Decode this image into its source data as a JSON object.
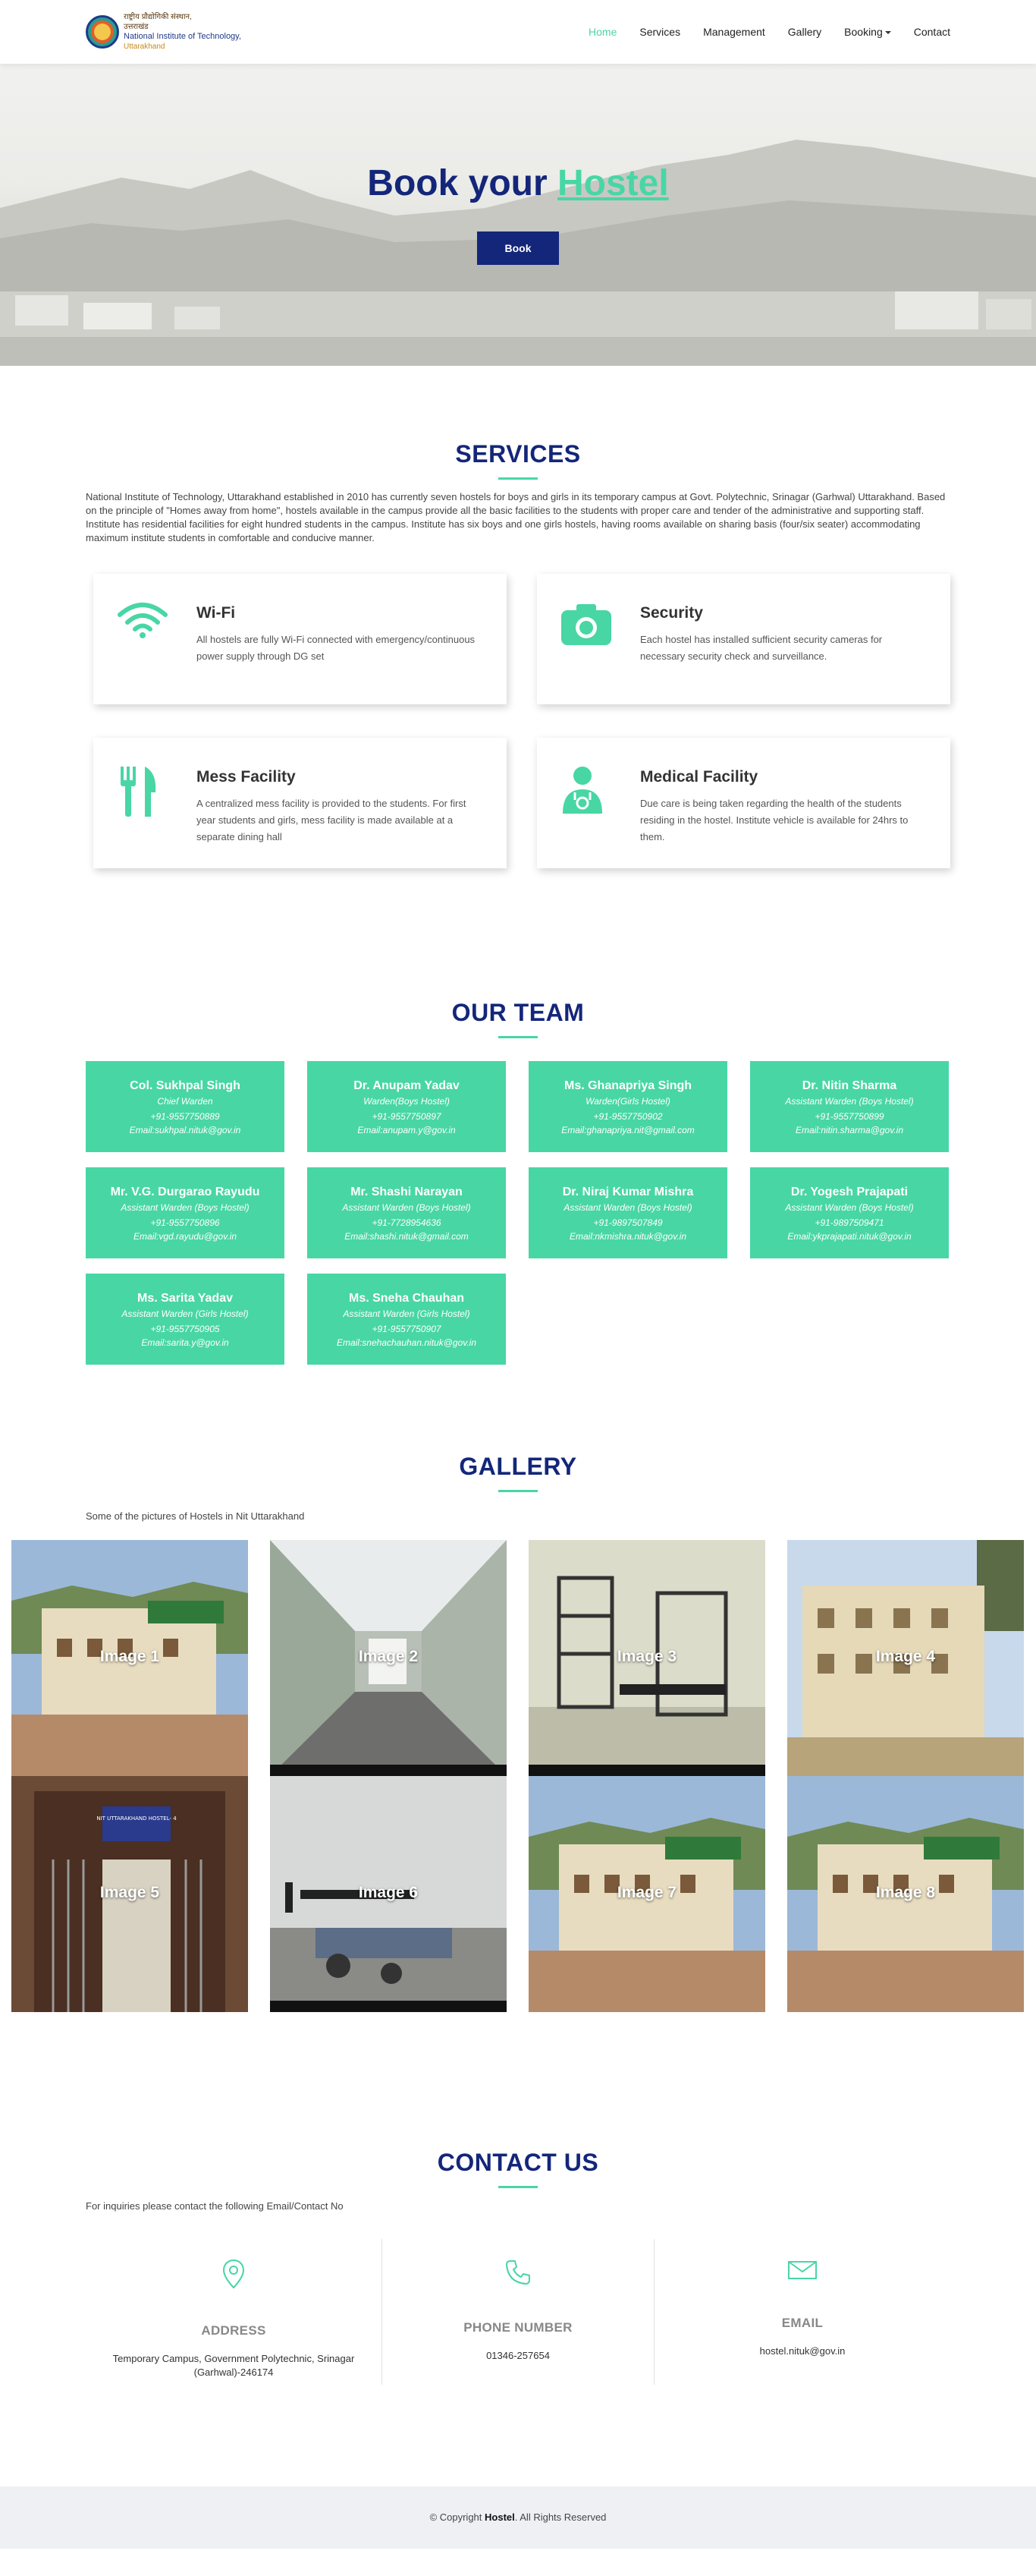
{
  "brand": {
    "line1": "राष्ट्रीय प्रौद्योगिकी संस्थान,",
    "line2": "उत्तराखंड",
    "line3": "National Institute of Technology,",
    "line4": "Uttarakhand"
  },
  "nav": {
    "items": [
      "Home",
      "Services",
      "Management",
      "Gallery",
      "Booking",
      "Contact"
    ]
  },
  "hero": {
    "title_prefix": "Book your ",
    "title_accent": "Hostel",
    "button": "Book"
  },
  "services": {
    "title": "SERVICES",
    "intro": "National Institute of Technology, Uttarakhand established in 2010 has currently seven hostels for boys and girls in its temporary campus at Govt. Polytechnic, Srinagar (Garhwal) Uttarakhand. Based on the principle of \"Homes away from home\", hostels available in the campus provide all the basic facilities to the students with proper care and tender of the administrative and supporting staff. Institute has residential facilities for eight hundred students in the campus. Institute has six boys and one girls hostels, having rooms available on sharing basis (four/six seater) accommodating maximum institute students in comfortable and conducive manner.",
    "cards": [
      {
        "title": "Wi-Fi",
        "text": "All hostels are fully Wi-Fi connected with emergency/continuous power supply through DG set",
        "icon": "wifi-icon"
      },
      {
        "title": "Security",
        "text": "Each hostel has installed sufficient security cameras for necessary security check and surveillance.",
        "icon": "camera-icon"
      },
      {
        "title": "Mess Facility",
        "text": "A centralized mess facility is provided to the students. For first year students and girls, mess facility is made available at a separate dining hall",
        "icon": "utensils-icon"
      },
      {
        "title": "Medical Facility",
        "text": "Due care is being taken regarding the health of the students residing in the hostel. Institute vehicle is available for 24hrs to them.",
        "icon": "doctor-icon"
      }
    ]
  },
  "team": {
    "title": "OUR TEAM",
    "members": [
      {
        "name": "Col. Sukhpal Singh",
        "role": "Chief Warden",
        "phone": "+91-9557750889",
        "email": "Email:sukhpal.nituk@gov.in"
      },
      {
        "name": "Dr. Anupam Yadav",
        "role": "Warden(Boys Hostel)",
        "phone": "+91-9557750897",
        "email": "Email:anupam.y@gov.in"
      },
      {
        "name": "Ms. Ghanapriya Singh",
        "role": "Warden(Girls Hostel)",
        "phone": "+91-9557750902",
        "email": "Email:ghanapriya.nit@gmail.com"
      },
      {
        "name": "Dr. Nitin Sharma",
        "role": "Assistant Warden (Boys Hostel)",
        "phone": "+91-9557750899",
        "email": "Email:nitin.sharma@gov.in"
      },
      {
        "name": "Mr. V.G. Durgarao Rayudu",
        "role": "Assistant Warden (Boys Hostel)",
        "phone": "+91-9557750896",
        "email": "Email:vgd.rayudu@gov.in"
      },
      {
        "name": "Mr. Shashi Narayan",
        "role": "Assistant Warden (Boys Hostel)",
        "phone": "+91-7728954636",
        "email": "Email:shashi.nituk@gmail.com"
      },
      {
        "name": "Dr. Niraj Kumar Mishra",
        "role": "Assistant Warden (Boys Hostel)",
        "phone": "+91-9897507849",
        "email": "Email:nkmishra.nituk@gov.in"
      },
      {
        "name": "Dr. Yogesh Prajapati",
        "role": "Assistant Warden (Boys Hostel)",
        "phone": "+91-9897509471",
        "email": "Email:ykprajapati.nituk@gov.in"
      },
      {
        "name": "Ms. Sarita Yadav",
        "role": "Assistant Warden (Girls Hostel)",
        "phone": "+91-9557750905",
        "email": "Email:sarita.y@gov.in"
      },
      {
        "name": "Ms. Sneha Chauhan",
        "role": "Assistant Warden (Girls Hostel)",
        "phone": "+91-9557750907",
        "email": "Email:snehachauhan.nituk@gov.in"
      }
    ]
  },
  "gallery": {
    "title": "GALLERY",
    "subtitle": "Some of the pictures of Hostels in Nit Uttarakhand",
    "items": [
      "Image 1",
      "Image 2",
      "Image 3",
      "Image 4",
      "Image 5",
      "Image 6",
      "Image 7",
      "Image 8"
    ],
    "sign_text": "NIT UTTARAKHAND HOSTEL- 4"
  },
  "contact": {
    "title": "CONTACT US",
    "subtitle": "For inquiries please contact the following Email/Contact No",
    "address_label": "ADDRESS",
    "address": "Temporary Campus, Government Polytechnic, Srinagar (Garhwal)-246174",
    "phone_label": "PHONE NUMBER",
    "phone": "01346-257654",
    "email_label": "EMAIL",
    "email": "hostel.nituk@gov.in"
  },
  "footer": {
    "prefix": "© Copyright ",
    "brand": "Hostel",
    "suffix": ". All Rights Reserved"
  },
  "colors": {
    "accent": "#48d6a5",
    "primary": "#13267a"
  }
}
